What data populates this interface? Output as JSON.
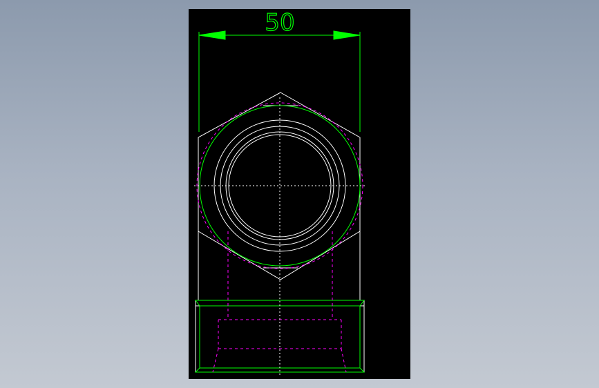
{
  "drawing": {
    "background_color": "#000000",
    "outline_color": "#ffffff",
    "dimension_color": "#00ff00",
    "hidden_line_color": "#ff00ff",
    "center_line_color": "#ffffff",
    "dimension": {
      "value": "50"
    }
  }
}
